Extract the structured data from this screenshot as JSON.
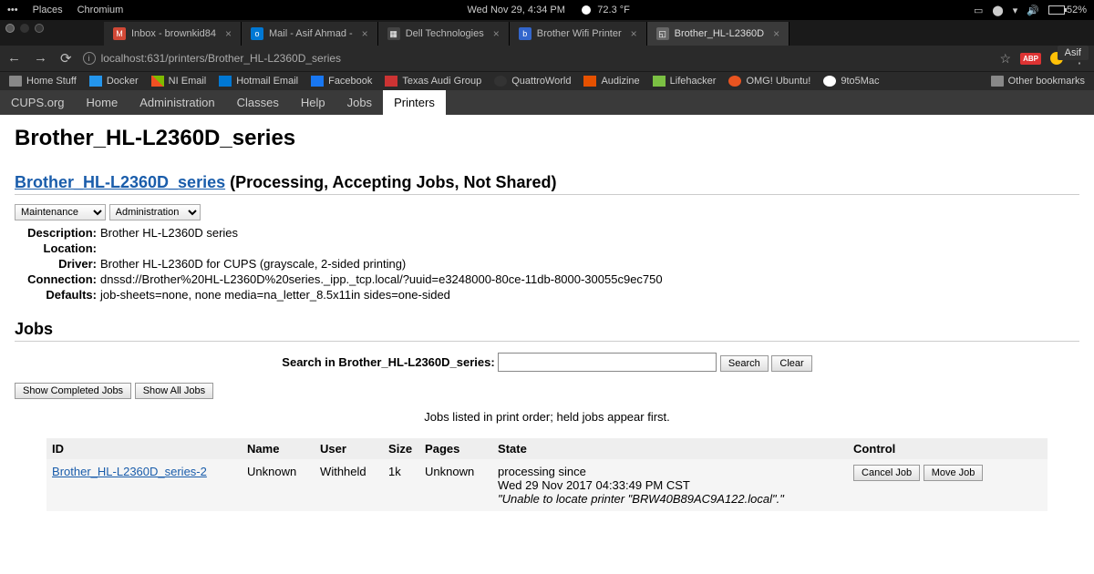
{
  "topbar": {
    "places": "Places",
    "app": "Chromium",
    "datetime": "Wed Nov 29,  4:34 PM",
    "temp": "72.3 °F",
    "battery": "52%"
  },
  "tabs": [
    {
      "label": "Inbox - brownkid84"
    },
    {
      "label": "Mail - Asif Ahmad -"
    },
    {
      "label": "Dell Technologies"
    },
    {
      "label": "Brother Wifi Printer"
    },
    {
      "label": "Brother_HL-L2360D"
    }
  ],
  "user": "Asif",
  "url": "localhost:631/printers/Brother_HL-L2360D_series",
  "bookmarks": {
    "items": [
      "Home Stuff",
      "Docker",
      "NI Email",
      "Hotmail Email",
      "Facebook",
      "Texas Audi Group",
      "QuattroWorld",
      "Audizine",
      "Lifehacker",
      "OMG! Ubuntu!",
      "9to5Mac"
    ],
    "other": "Other bookmarks"
  },
  "cupsnav": [
    "CUPS.org",
    "Home",
    "Administration",
    "Classes",
    "Help",
    "Jobs",
    "Printers"
  ],
  "page": {
    "title": "Brother_HL-L2360D_series",
    "printer_link": "Brother_HL-L2360D_series",
    "status": "(Processing, Accepting Jobs, Not Shared)",
    "maintenance": "Maintenance",
    "administration": "Administration",
    "props": {
      "description_label": "Description:",
      "description": "Brother HL-L2360D series",
      "location_label": "Location:",
      "location": "",
      "driver_label": "Driver:",
      "driver": "Brother HL-L2360D for CUPS (grayscale, 2-sided printing)",
      "connection_label": "Connection:",
      "connection": "dnssd://Brother%20HL-L2360D%20series._ipp._tcp.local/?uuid=e3248000-80ce-11db-8000-30055c9ec750",
      "defaults_label": "Defaults:",
      "defaults": "job-sheets=none, none media=na_letter_8.5x11in sides=one-sided"
    },
    "jobs_heading": "Jobs",
    "search_label": "Search in Brother_HL-L2360D_series:",
    "search_btn": "Search",
    "clear_btn": "Clear",
    "show_completed": "Show Completed Jobs",
    "show_all": "Show All Jobs",
    "note": "Jobs listed in print order; held jobs appear first.",
    "headers": {
      "id": "ID",
      "name": "Name",
      "user": "User",
      "size": "Size",
      "pages": "Pages",
      "state": "State",
      "control": "Control"
    },
    "job": {
      "id": "Brother_HL-L2360D_series-2",
      "name": "Unknown",
      "user": "Withheld",
      "size": "1k",
      "pages": "Unknown",
      "state1": "processing since",
      "state2": "Wed 29 Nov 2017 04:33:49 PM CST",
      "state3": "\"Unable to locate printer \"BRW40B89AC9A122.local\".\"",
      "cancel": "Cancel Job",
      "move": "Move Job"
    }
  }
}
